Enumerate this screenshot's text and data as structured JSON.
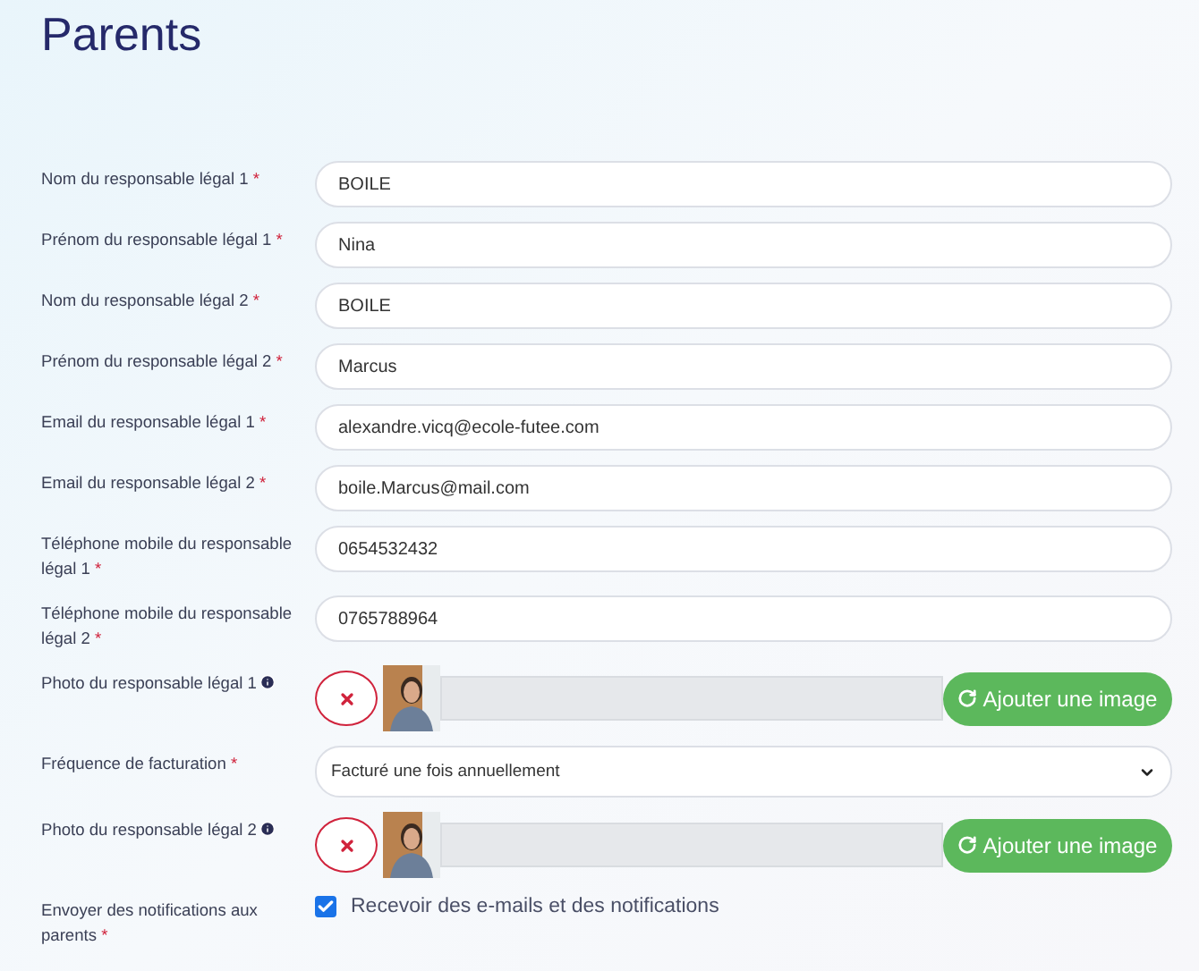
{
  "title": "Parents",
  "fields": [
    {
      "kind": "text",
      "label": "Nom du responsable légal 1",
      "required": "*",
      "value": "BOILE"
    },
    {
      "kind": "text",
      "label": "Prénom du responsable légal 1",
      "required": "*",
      "value": "Nina"
    },
    {
      "kind": "text",
      "label": "Nom du responsable légal 2",
      "required": "*",
      "value": "BOILE"
    },
    {
      "kind": "text",
      "label": "Prénom du responsable légal 2",
      "required": "*",
      "value": "Marcus"
    },
    {
      "kind": "text",
      "label": "Email du responsable légal 1",
      "required": "*",
      "value": "alexandre.vicq@ecole-futee.com"
    },
    {
      "kind": "text",
      "label": "Email du responsable légal 2",
      "required": "*",
      "value": "boile.Marcus@mail.com"
    },
    {
      "kind": "text",
      "label": "Téléphone mobile du responsable légal 1",
      "required": "*",
      "value": "0654532432"
    },
    {
      "kind": "text",
      "label": "Téléphone mobile du responsable légal 2",
      "required": "*",
      "value": "0765788964"
    },
    {
      "label": "Photo du responsable légal 1",
      "info": true,
      "button": "Ajouter une image"
    },
    {
      "kind": "select",
      "label": "Fréquence de facturation",
      "required": "*",
      "value": "Facturé une fois annuellement"
    },
    {
      "label": "Photo du responsable légal 2",
      "info": true,
      "button": "Ajouter une image"
    },
    {
      "kind": "checkbox",
      "label": "Envoyer des notifications aux parents",
      "required": "*",
      "checked": true,
      "option": "Recevoir des e-mails et des notifications"
    }
  ]
}
